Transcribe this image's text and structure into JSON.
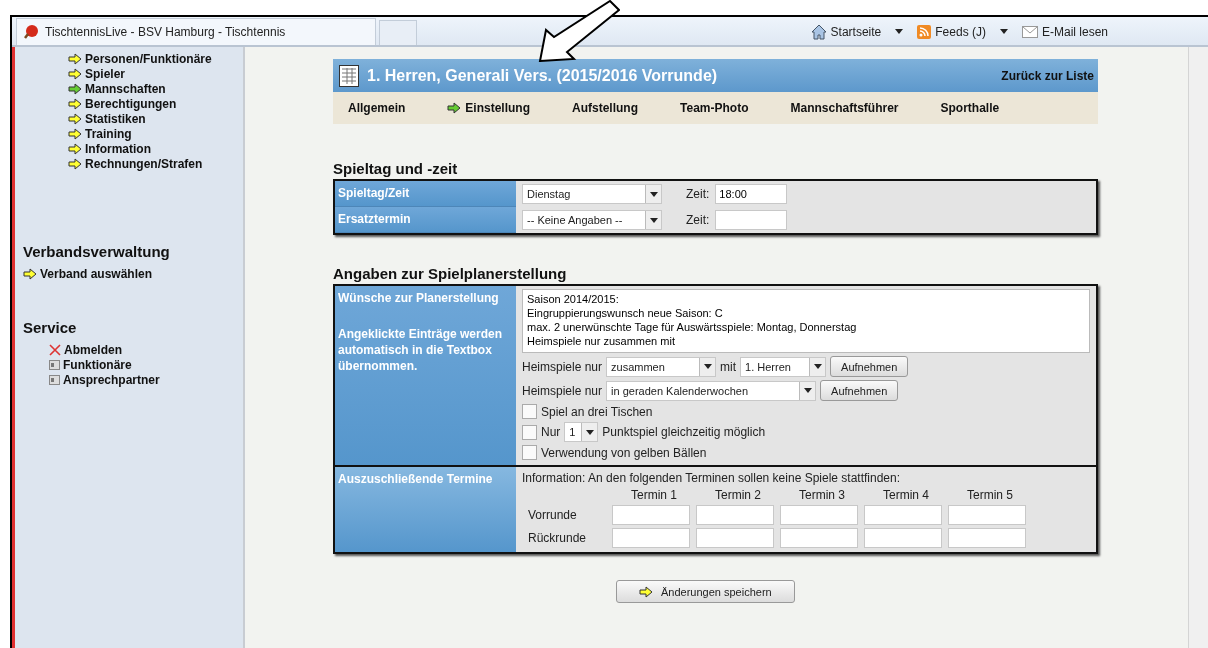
{
  "browser": {
    "tab_title": "TischtennisLive - BSV Hamburg - Tischtennis",
    "toolbar": [
      {
        "kind": "home",
        "label": "Startseite",
        "dropdown": true
      },
      {
        "kind": "feed",
        "label": "Feeds (J)",
        "dropdown": true
      },
      {
        "kind": "mail",
        "label": "E-Mail lesen",
        "dropdown": false
      }
    ]
  },
  "sidebar": {
    "items": [
      {
        "label": "Personen/Funktionäre",
        "selected": false
      },
      {
        "label": "Spieler",
        "selected": false
      },
      {
        "label": "Mannschaften",
        "selected": true
      },
      {
        "label": "Berechtigungen",
        "selected": false
      },
      {
        "label": "Statistiken",
        "selected": false
      },
      {
        "label": "Training",
        "selected": false
      },
      {
        "label": "Information",
        "selected": false
      },
      {
        "label": "Rechnungen/Strafen",
        "selected": false
      }
    ],
    "sections": [
      {
        "title": "Verbandsverwaltung",
        "items": [
          {
            "kind": "arrow",
            "label": "Verband auswählen"
          }
        ]
      },
      {
        "title": "Service",
        "items": [
          {
            "kind": "cross",
            "label": "Abmelden"
          },
          {
            "kind": "card",
            "label": "Funktionäre"
          },
          {
            "kind": "card",
            "label": "Ansprechpartner"
          }
        ]
      }
    ]
  },
  "header": {
    "title": "1. Herren, Generali Vers. (2015/2016 Vorrunde)",
    "back_link": "Zurück zur Liste"
  },
  "tabs": [
    {
      "label": "Allgemein",
      "selected": false
    },
    {
      "label": "Einstellung",
      "selected": true
    },
    {
      "label": "Aufstellung",
      "selected": false
    },
    {
      "label": "Team-Photo",
      "selected": false
    },
    {
      "label": "Mannschaftsführer",
      "selected": false
    },
    {
      "label": "Sporthalle",
      "selected": false
    }
  ],
  "schedule": {
    "heading": "Spieltag und -zeit",
    "rows": [
      {
        "label": "Spieltag/Zeit",
        "select": "Dienstag",
        "time_label": "Zeit:",
        "time": "18:00"
      },
      {
        "label": "Ersatztermin",
        "select": "-- Keine Angaben --",
        "time_label": "Zeit:",
        "time": ""
      }
    ]
  },
  "planning": {
    "heading": "Angaben zur Spielplanerstellung",
    "wishes_label": "Wünsche zur Planerstellung",
    "hint": "Angeklickte Einträge werden automatisch in die Textbox übernommen.",
    "wishes_text": "Saison 2014/2015:\nEingruppierungswunsch neue Saison: C\nmax. 2 unerwünschte Tage für Auswärtsspiele: Montag, Donnerstag\nHeimspiele nur zusammen mit",
    "home_rows": [
      {
        "label": "Heimspiele nur",
        "select": "zusammen",
        "connector": "mit",
        "select2": "1. Herren",
        "button": "Aufnehmen"
      },
      {
        "label": "Heimspiele nur",
        "select": "in geraden Kalenderwochen",
        "button": "Aufnehmen"
      }
    ],
    "options": [
      {
        "kind": "plain",
        "label": "Spiel an drei Tischen",
        "checked": false
      },
      {
        "kind": "count",
        "prefix": "Nur",
        "select": "1",
        "label": "Punktspiel gleichzeitig möglich",
        "checked": false
      },
      {
        "kind": "plain",
        "label": "Verwendung von gelben Bällen",
        "checked": false
      }
    ],
    "exclude_label": "Auszuschließende Termine",
    "info": "Information: An den folgenden Terminen sollen keine Spiele stattfinden:",
    "columns": [
      "Termin 1",
      "Termin 2",
      "Termin 3",
      "Termin 4",
      "Termin 5"
    ],
    "rounds": [
      "Vorrunde",
      "Rückrunde"
    ]
  },
  "save_button": "Änderungen speichern"
}
